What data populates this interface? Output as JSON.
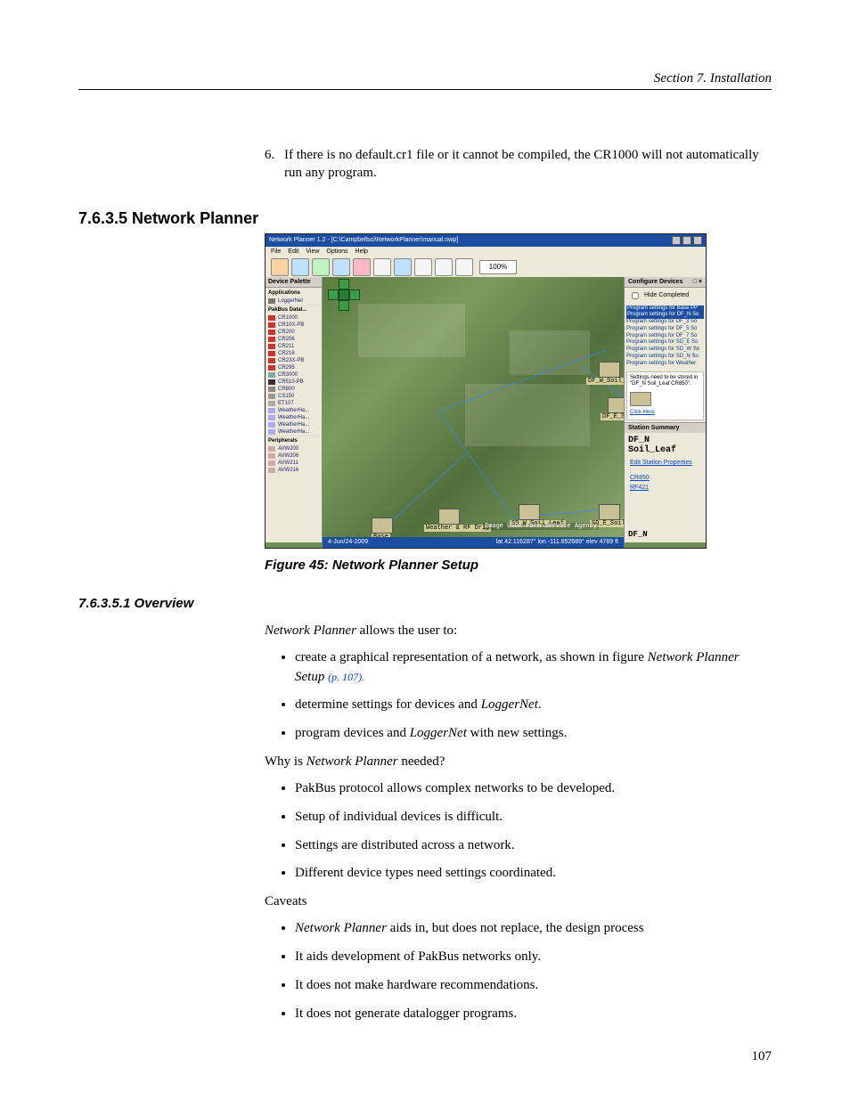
{
  "header": {
    "section": "Section 7.  Installation"
  },
  "step6": {
    "num": "6.",
    "text_a": "If there is no default.cr1 file or it cannot be compiled, the CR1000 will not automatically run any program."
  },
  "h_network_planner": "7.6.3.5 Network Planner",
  "figure": {
    "caption": "Figure 45: Network Planner Setup",
    "title": "Network Planner 1.2 - [C:\\Campbellsci\\NetworkPlanner\\manual.nwp]",
    "menu": [
      "File",
      "Edit",
      "View",
      "Options",
      "Help"
    ],
    "zoom": "100%",
    "left_panel": {
      "title": "Device Palette",
      "groups": [
        {
          "name": "Applications",
          "items": [
            "LoggerNet"
          ]
        },
        {
          "name": "PakBus Datal...",
          "items": [
            "CR1000",
            "CR10X-PB",
            "CR200",
            "CR206",
            "CR211",
            "CR216",
            "CR23X-PB",
            "CR295",
            "CR3000",
            "CR510-PB",
            "CR800",
            "CS150",
            "ET107",
            "WeatherHa...",
            "WeatherHa...",
            "WeatherHa...",
            "WeatherHa..."
          ]
        },
        {
          "name": "Peripherals",
          "items": [
            "AVW200",
            "AVW206",
            "AVW211",
            "AVW216"
          ]
        }
      ]
    },
    "right_panel": {
      "configure_title": "Configure Devices",
      "hide_completed": "Hide Completed",
      "program_list": [
        "Program settings for Base PP",
        "Program settings for DF_N So",
        "Program settings for DF_3 So",
        "Program settings for DF_5 So",
        "Program settings for DF_7 So",
        "Program settings for SD_E So",
        "Program settings for SD_W So",
        "Program settings for SD_N So",
        "Program settings for Weather"
      ],
      "hint": "Settings need to be stored in \"DF_N Soil_Leaf CR850\".",
      "click_here": "Click Here",
      "summary_title": "Station Summary",
      "station_line1": "DF_N",
      "station_line2": "Soil_Leaf",
      "edit_props": "Edit Station Properties",
      "links": [
        "CR850",
        "RF421"
      ],
      "bottom_label": "DF_N"
    },
    "map": {
      "statusbar_left": "4-Jun/24-2009",
      "statusbar_center": "lat  42.116287°   lon -111.852689°   elev  4789 ft",
      "labels": {
        "base": "Base",
        "weather": "Weather & RF Drip",
        "credit": "Image USDA Farm Service Agency",
        "sd_w": "SD_W_Soil_Leaf",
        "sd_e": "SD_E_Soil",
        "df_w": "DF_W_Soil_Leaf",
        "df_e": "DF_E_Soil"
      }
    }
  },
  "h_overview": "7.6.3.5.1 Overview",
  "overview": {
    "intro_a_i": "Network Planner",
    "intro_a_t": " allows the user to:",
    "b1_a": "create a graphical representation of a network, as shown in figure ",
    "b1_i": "Network Planner Setup ",
    "b1_r": "(p. 107).",
    "b2_a": "determine settings for devices and ",
    "b2_i": "LoggerNet",
    "b2_t": ".",
    "b3_a": "program devices and ",
    "b3_i": "LoggerNet",
    "b3_t": " with new settings.",
    "why_a": "Why is ",
    "why_i": "Network Planner",
    "why_t": " needed?",
    "w1": "PakBus protocol allows complex networks to be developed.",
    "w2": "Setup of individual devices is difficult.",
    "w3": "Settings are distributed across a network.",
    "w4": "Different device types need settings coordinated.",
    "caveats": "Caveats",
    "c1_i": "Network Planner",
    "c1_t": " aids in, but does not replace, the design process",
    "c2": "It aids development of PakBus networks only.",
    "c3": "It does not make hardware recommendations.",
    "c4": "It does not generate datalogger programs."
  },
  "page_number": "107"
}
